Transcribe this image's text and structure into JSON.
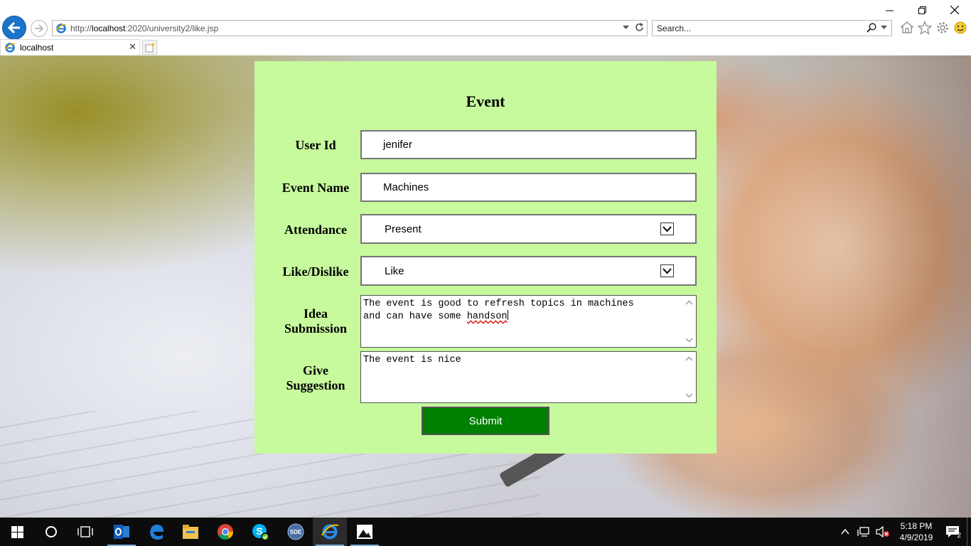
{
  "browser": {
    "url_prefix": "http://",
    "url_host": "localhost",
    "url_rest": ":2020/university2/like.jsp",
    "search_placeholder": "Search...",
    "tab_title": "localhost"
  },
  "form": {
    "title": "Event",
    "user_id": {
      "label": "User Id",
      "value": "jenifer"
    },
    "event_name": {
      "label": "Event Name",
      "value": "Machines"
    },
    "attendance": {
      "label": "Attendance",
      "value": "Present"
    },
    "like_dislike": {
      "label": "Like/Dislike",
      "value": "Like"
    },
    "idea_submission": {
      "label_line1": "Idea",
      "label_line2": "Submission",
      "value_part1": "The event is good to refresh topics in machines\nand can have some ",
      "value_misspelled": "handson"
    },
    "give_suggestion": {
      "label_line1": "Give",
      "label_line2": "Suggestion",
      "value": "The event is nice"
    },
    "submit_label": "Submit"
  },
  "taskbar": {
    "apps": [
      "start-icon",
      "cortana-icon",
      "task-view-icon",
      "outlook-icon",
      "edge-icon",
      "file-explorer-icon",
      "chrome-icon",
      "skype-icon",
      "sde-icon",
      "internet-explorer-icon",
      "photos-icon"
    ],
    "active_app": "internet-explorer-icon",
    "sde_label": "SDE",
    "time": "5:18 PM",
    "date": "4/9/2019",
    "notification_count": "2"
  },
  "colors": {
    "form_background": "#c7f99d",
    "submit_background": "#008000",
    "back_button": "#1b74c9"
  }
}
